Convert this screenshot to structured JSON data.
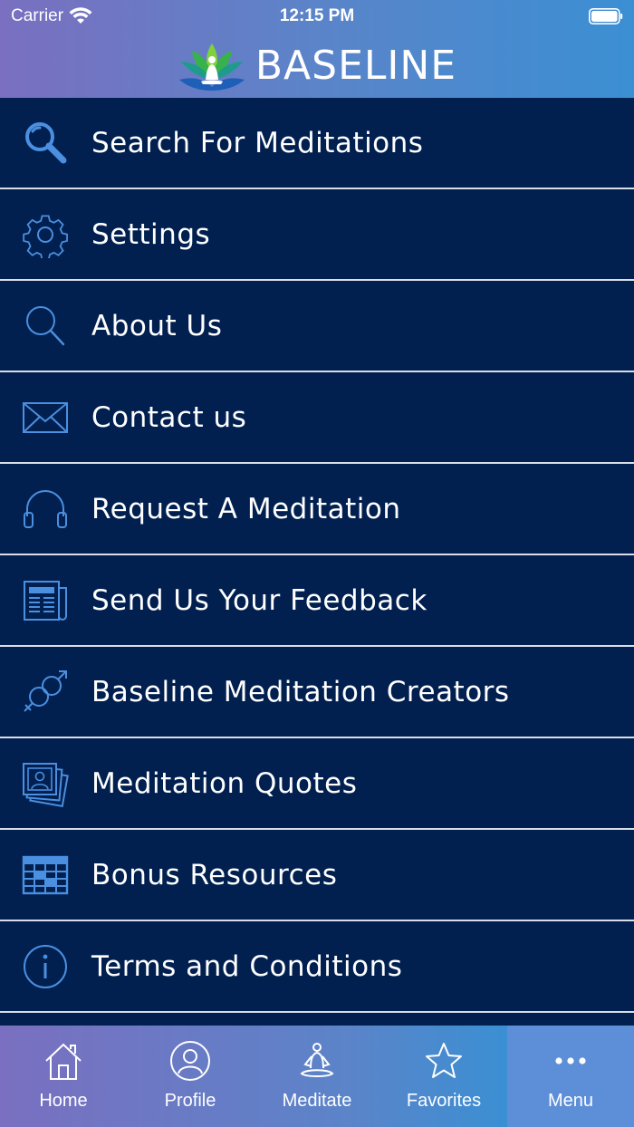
{
  "status_bar": {
    "carrier": "Carrier",
    "time": "12:15 PM"
  },
  "header": {
    "title": "BASELINE"
  },
  "colors": {
    "menu_background": "#012050",
    "divider": "#d8dde6",
    "icon_blue": "#4a8fe0",
    "header_gradient_start": "#7a6fc0",
    "header_gradient_end": "#3b8fd3",
    "active_tab": "#5d8fd8"
  },
  "menu": {
    "items": [
      {
        "label": "Search For Meditations",
        "icon": "magnifier-icon"
      },
      {
        "label": "Settings",
        "icon": "gear-icon"
      },
      {
        "label": "About Us",
        "icon": "search-icon"
      },
      {
        "label": "Contact us",
        "icon": "envelope-icon"
      },
      {
        "label": "Request A Meditation",
        "icon": "headphones-icon"
      },
      {
        "label": "Send Us Your Feedback",
        "icon": "newspaper-icon"
      },
      {
        "label": "Baseline Meditation Creators",
        "icon": "gender-icon"
      },
      {
        "label": "Meditation Quotes",
        "icon": "photos-icon"
      },
      {
        "label": "Bonus Resources",
        "icon": "table-icon"
      },
      {
        "label": "Terms and Conditions",
        "icon": "info-icon"
      }
    ]
  },
  "tabs": {
    "items": [
      {
        "label": "Home",
        "icon": "home-icon"
      },
      {
        "label": "Profile",
        "icon": "profile-icon"
      },
      {
        "label": "Meditate",
        "icon": "meditate-icon"
      },
      {
        "label": "Favorites",
        "icon": "star-icon"
      },
      {
        "label": "Menu",
        "icon": "more-icon"
      }
    ],
    "active": "Menu"
  }
}
